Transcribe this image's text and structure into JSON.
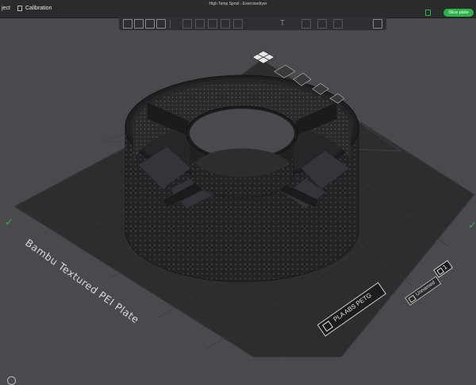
{
  "window": {
    "title": "High Temp Spool - Exercisedryer"
  },
  "menu": {
    "items": [
      {
        "label": "ject"
      },
      {
        "label": "Calibration"
      }
    ]
  },
  "header": {
    "slice_label": "Slice plate"
  },
  "plate": {
    "label": "Bambu Textured PEI Plate",
    "filaments": "PLA ABS PETG",
    "plate_name": "Unnamed",
    "plate_number": "1"
  },
  "colors": {
    "accent": "#2bb34a",
    "plate": "#2d2d30",
    "model": "#222224",
    "background": "#4a4a4e"
  },
  "icons": {
    "toolbar": [
      "add-object-icon",
      "grid-icon",
      "orient-icon",
      "auto-arrange-icon",
      "layout-icon",
      "split-icon",
      "cut-icon",
      "text-icon",
      "support-paint-icon",
      "seam-icon",
      "assembly-icon"
    ],
    "viewport": [
      "check-icon",
      "lock-icon",
      "settings-icon"
    ]
  }
}
